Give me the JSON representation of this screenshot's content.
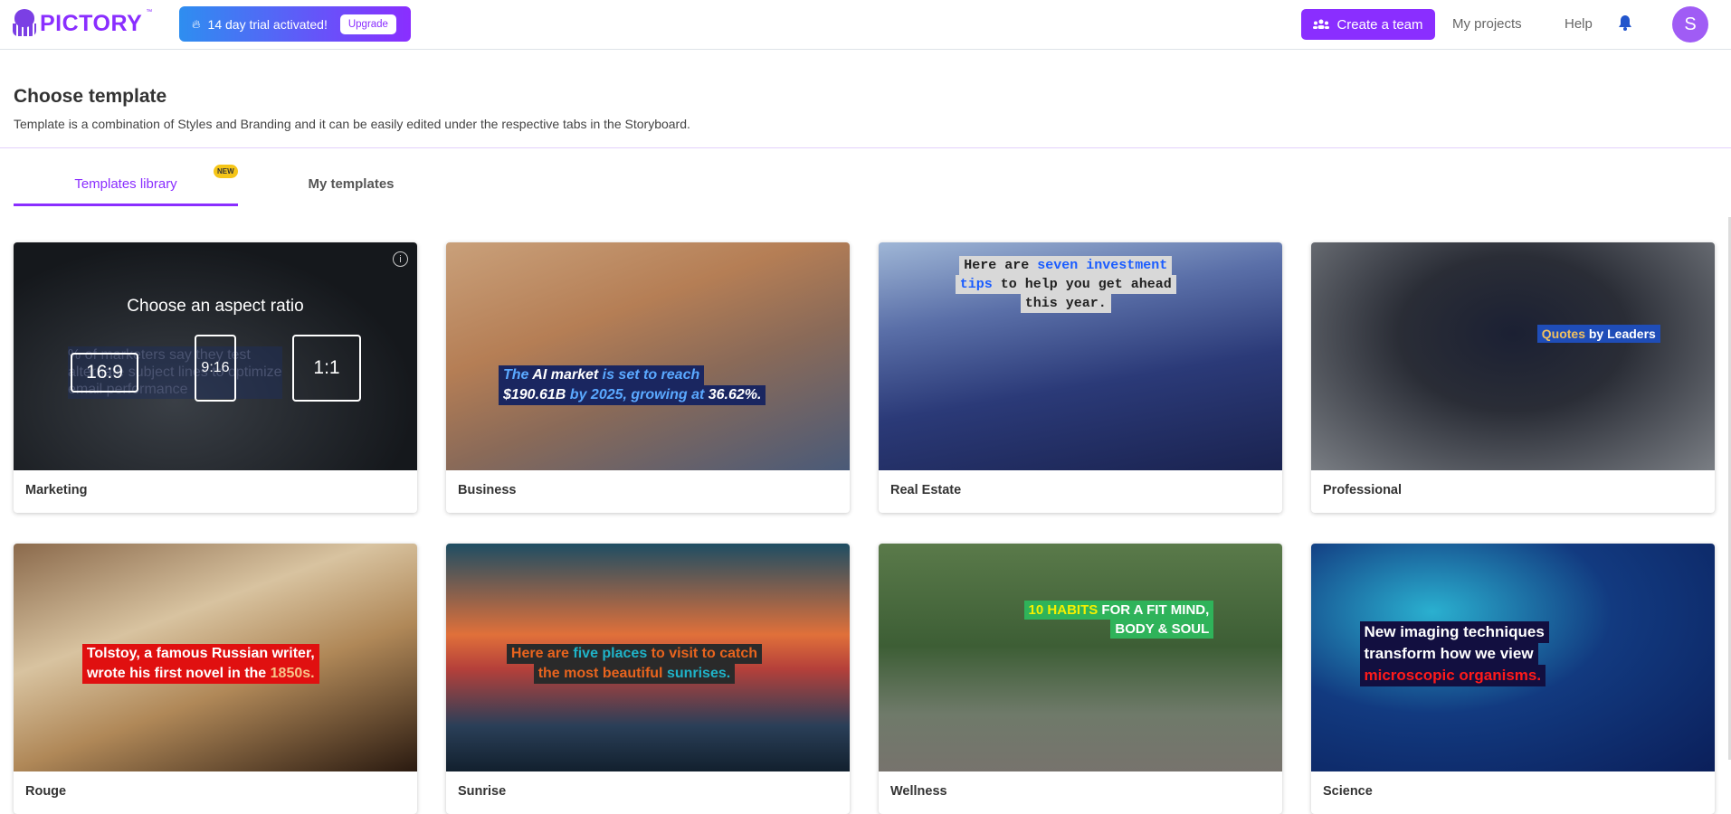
{
  "header": {
    "logo_text": "PICTORY",
    "logo_tm": "™",
    "trial_text": "14 day trial activated!",
    "upgrade_label": "Upgrade",
    "create_team_label": "Create a team",
    "my_projects_label": "My projects",
    "help_label": "Help",
    "avatar_initial": "S"
  },
  "page": {
    "title": "Choose template",
    "subtitle": "Template is a combination of Styles and Branding and it can be easily edited under the respective tabs in the Storyboard."
  },
  "tabs": [
    {
      "label": "Templates library",
      "active": true,
      "badge": "NEW"
    },
    {
      "label": "My templates",
      "active": false
    }
  ],
  "colors": {
    "accent": "#8a2eff",
    "trial_gradient_start": "#2e8ef0",
    "badge": "#f5c518"
  },
  "marketing_card": {
    "overlay_title": "Choose an aspect ratio",
    "ratios": [
      "16:9",
      "9:16",
      "1:1"
    ],
    "background_text": [
      "% of marketers say they test",
      "alternate subject lines to optimize",
      "email performance"
    ]
  },
  "templates": [
    {
      "name": "Marketing"
    },
    {
      "name": "Business",
      "overlay": [
        [
          {
            "t": "The ",
            "c": "#5aa8ff"
          },
          {
            "t": "AI market",
            "c": "#ffffff"
          },
          {
            "t": " is set to reach",
            "c": "#5aa8ff"
          }
        ],
        [
          {
            "t": "$190.61B",
            "c": "#ffffff"
          },
          {
            "t": " by 2025, growing at ",
            "c": "#5aa8ff"
          },
          {
            "t": "36.62%.",
            "c": "#ffffff"
          }
        ]
      ]
    },
    {
      "name": "Real Estate",
      "overlay": [
        [
          {
            "t": "Here are ",
            "c": "#222222"
          },
          {
            "t": "seven investment",
            "c": "#1a5cff"
          }
        ],
        [
          {
            "t": "tips",
            "c": "#1a5cff"
          },
          {
            "t": " to help you get ahead",
            "c": "#222222"
          }
        ],
        [
          {
            "t": "this year.",
            "c": "#222222"
          }
        ]
      ]
    },
    {
      "name": "Professional",
      "overlay": [
        [
          {
            "t": "Quotes",
            "c": "#f0c060"
          },
          {
            "t": " by Leaders",
            "c": "#ffffff"
          }
        ]
      ]
    },
    {
      "name": "Rouge",
      "overlay": [
        [
          {
            "t": "Tolstoy, a famous Russian writer,",
            "c": "#ffffff"
          }
        ],
        [
          {
            "t": "wrote his first novel in the ",
            "c": "#ffffff"
          },
          {
            "t": "1850s.",
            "c": "#f7c48a"
          }
        ]
      ]
    },
    {
      "name": "Sunrise",
      "overlay": [
        [
          {
            "t": "Here are ",
            "c": "#e8641e"
          },
          {
            "t": "five places",
            "c": "#1fb3c8"
          },
          {
            "t": " to visit to catch",
            "c": "#e8641e"
          }
        ],
        [
          {
            "t": "the most beautiful ",
            "c": "#e8641e"
          },
          {
            "t": "sunrises.",
            "c": "#1fb3c8"
          }
        ]
      ]
    },
    {
      "name": "Wellness",
      "overlay": [
        [
          {
            "t": "10 HABITS",
            "c": "#f5f000"
          },
          {
            "t": " FOR A FIT MIND,",
            "c": "#ffffff"
          }
        ],
        [
          {
            "t": "BODY & SOUL",
            "c": "#ffffff"
          }
        ]
      ]
    },
    {
      "name": "Science",
      "overlay": [
        [
          {
            "t": "New imaging techniques",
            "c": "#ffffff"
          }
        ],
        [
          {
            "t": "transform how we view",
            "c": "#ffffff"
          }
        ],
        [
          {
            "t": "microscopic organisms.",
            "c": "#ff1a1a"
          }
        ]
      ]
    }
  ]
}
